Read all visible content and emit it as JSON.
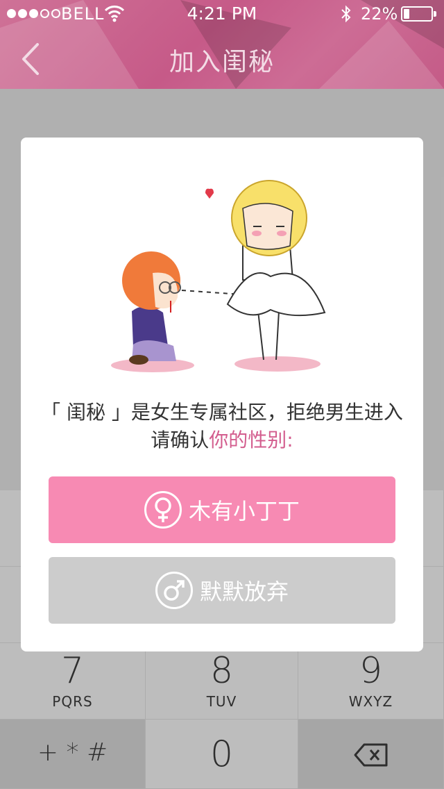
{
  "status_bar": {
    "carrier": "BELL",
    "time": "4:21 PM",
    "battery": "22%",
    "battery_level": 0.22
  },
  "nav": {
    "title": "加入闺秘",
    "back_icon": "chevron-left-icon"
  },
  "dialog": {
    "message_line1": "「 闺秘 」是女生专属社区，拒绝男生进入",
    "message_line2_prefix": "请确认",
    "message_line2_highlight": "你的性别:",
    "female_button": "木有小丁丁",
    "male_button": "默默放弃",
    "colors": {
      "female": "#f78ab3",
      "male": "#cccccc",
      "highlight": "#d35d8e"
    }
  },
  "keypad": {
    "keys": [
      {
        "num": "7",
        "letters": "PQRS"
      },
      {
        "num": "8",
        "letters": "TUV"
      },
      {
        "num": "9",
        "letters": "WXYZ"
      },
      {
        "num": "+ * #",
        "letters": ""
      },
      {
        "num": "0",
        "letters": ""
      },
      {
        "num": "",
        "letters": ""
      }
    ]
  }
}
